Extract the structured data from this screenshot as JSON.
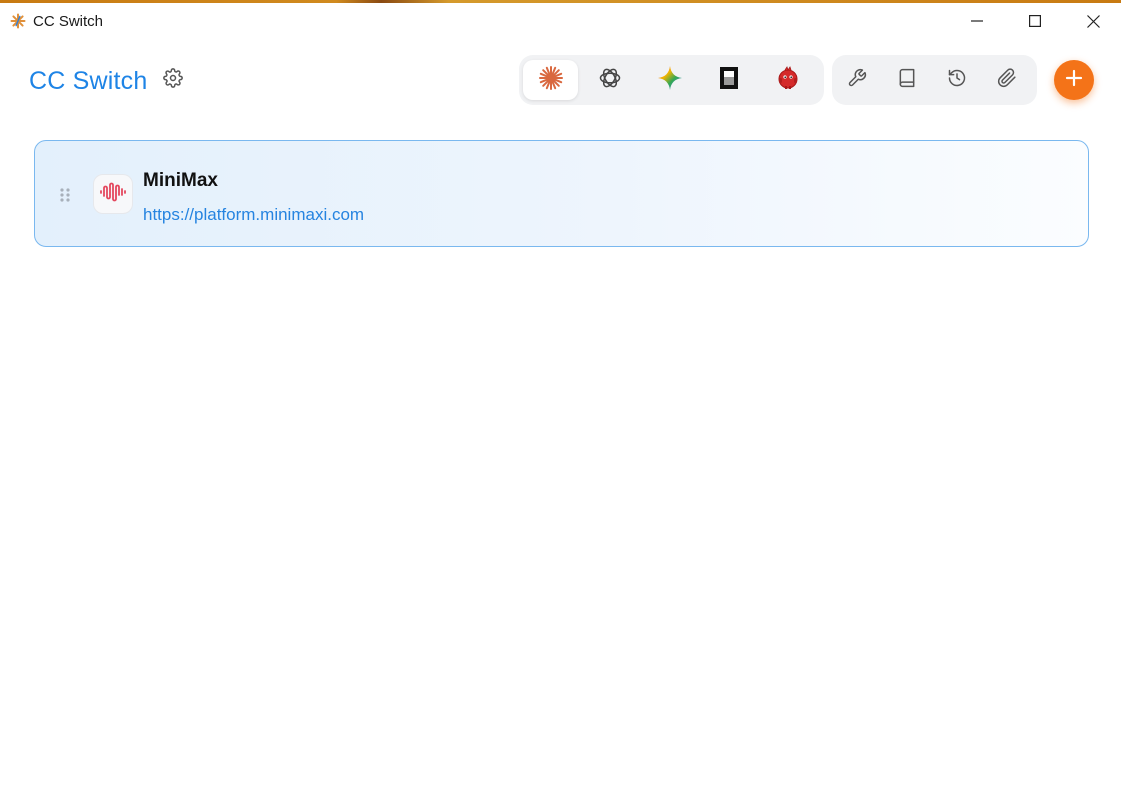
{
  "window": {
    "title": "CC Switch",
    "controls": {
      "minimize_icon": "minimize-icon",
      "maximize_icon": "maximize-icon",
      "close_icon": "close-icon"
    }
  },
  "header": {
    "brand": "CC Switch",
    "settings_icon": "gear-icon",
    "app_tabs": [
      {
        "name": "claude",
        "icon": "claude-starburst-icon",
        "active": true
      },
      {
        "name": "openai",
        "icon": "openai-knot-icon",
        "active": false
      },
      {
        "name": "gemini",
        "icon": "gemini-sparkle-icon",
        "active": false
      },
      {
        "name": "opencode",
        "icon": "opencode-square-icon",
        "active": false
      },
      {
        "name": "red-bird",
        "icon": "red-bird-icon",
        "active": false
      }
    ],
    "tools": [
      {
        "name": "tools",
        "icon": "wrench-icon"
      },
      {
        "name": "docs",
        "icon": "book-icon"
      },
      {
        "name": "history",
        "icon": "history-icon"
      },
      {
        "name": "attachments",
        "icon": "paperclip-icon"
      }
    ],
    "add_icon": "plus-icon"
  },
  "colors": {
    "brand": "#1e84e6",
    "accent_add": "#f47318",
    "card_border": "#7ab8ef",
    "link": "#2684e0"
  },
  "providers": [
    {
      "name": "MiniMax",
      "url": "https://platform.minimaxi.com",
      "logo_icon": "minimax-wave-icon",
      "active": true
    }
  ]
}
